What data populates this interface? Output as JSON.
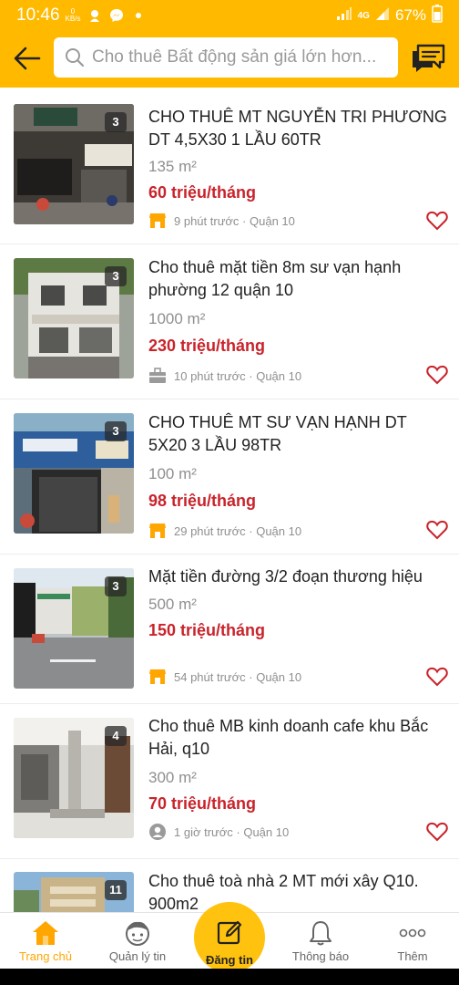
{
  "status_bar": {
    "time": "10:46",
    "kbps_value": "0",
    "kbps_unit": "KB/s",
    "network": "4G",
    "battery": "67%"
  },
  "header": {
    "search_placeholder": "Cho thuê Bất động sản giá lớn hơn..."
  },
  "listings": [
    {
      "title": "CHO THUÊ MT NGUYỄN TRI PHƯƠNG DT 4,5X30 1 LẦU 60TR",
      "area": "135 m²",
      "price": "60 triệu/tháng",
      "photo_count": "3",
      "time_ago": "9 phút trước",
      "district": "Quận 10",
      "poster_icon": "shop-icon"
    },
    {
      "title": "Cho thuê mặt tiền 8m sư vạn hạnh phường 12 quận 10",
      "area": "1000 m²",
      "price": "230 triệu/tháng",
      "photo_count": "3",
      "time_ago": "10 phút trước",
      "district": "Quận 10",
      "poster_icon": "briefcase-icon"
    },
    {
      "title": "CHO THUÊ MT SƯ VẠN HẠNH DT 5X20 3 LẦU 98TR",
      "area": "100 m²",
      "price": "98 triệu/tháng",
      "photo_count": "3",
      "time_ago": "29 phút trước",
      "district": "Quận 10",
      "poster_icon": "shop-icon"
    },
    {
      "title": "Mặt tiền đường 3/2 đoạn thương hiệu",
      "area": "500 m²",
      "price": "150 triệu/tháng",
      "photo_count": "3",
      "time_ago": "54 phút trước",
      "district": "Quận 10",
      "poster_icon": "shop-icon"
    },
    {
      "title": "Cho thuê MB kinh doanh cafe khu Bắc Hải, q10",
      "area": "300 m²",
      "price": "70 triệu/tháng",
      "photo_count": "4",
      "time_ago": "1 giờ trước",
      "district": "Quận 10",
      "poster_icon": "user-icon"
    },
    {
      "title": "Cho thuê toà nhà 2 MT mới xây Q10.",
      "area": "900m2",
      "photo_count": "11"
    }
  ],
  "bottom_nav": {
    "home": "Trang chủ",
    "manage": "Quản lý tin",
    "post": "Đăng tin",
    "notifications": "Thông báo",
    "more": "Thêm"
  },
  "colors": {
    "brand": "#ffba00",
    "price": "#c9232b",
    "heart": "#c9232b",
    "active_nav": "#ffa600"
  }
}
